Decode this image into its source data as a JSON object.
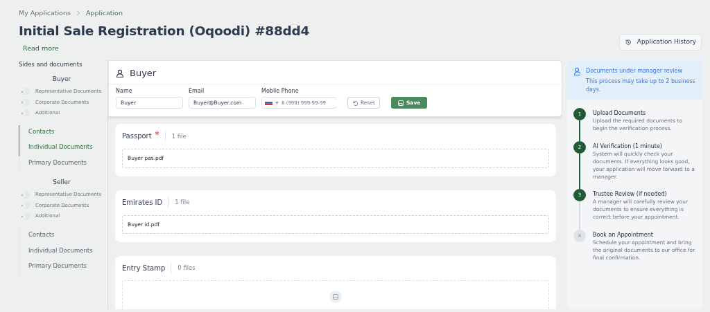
{
  "breadcrumb": [
    {
      "label": "My Applications",
      "selected": false
    },
    {
      "label": "Application",
      "selected": true
    }
  ],
  "title": "Initial Sale Registration (Oqoodi) #88dd4",
  "read_more": "Read more",
  "history_button": "Application History",
  "sidebar": {
    "heading": "Sides and documents",
    "sides": [
      {
        "name": "Buyer",
        "toggles": [
          {
            "label": "Representative Documents",
            "on": false
          },
          {
            "label": "Corporate Documents",
            "on": false
          },
          {
            "label": "Additional",
            "on": false
          }
        ],
        "items": [
          {
            "label": "Contacts",
            "selected": true
          },
          {
            "label": "Individual Documents",
            "selected": true
          },
          {
            "label": "Primary Documents",
            "selected": false
          }
        ]
      },
      {
        "name": "Seller",
        "toggles": [
          {
            "label": "Representative Documents",
            "on": false
          },
          {
            "label": "Corporate Documents",
            "on": false
          },
          {
            "label": "Additional",
            "on": false
          }
        ],
        "items": [
          {
            "label": "Contacts",
            "selected": false
          },
          {
            "label": "Individual Documents",
            "selected": false
          },
          {
            "label": "Primary Documents",
            "selected": false
          }
        ]
      }
    ]
  },
  "contact_card": {
    "title": "Buyer",
    "fields": [
      {
        "kind": "text",
        "label": "Name",
        "value": "Buyer"
      },
      {
        "kind": "text",
        "label": "Email",
        "value": "Buyer@Buyer.com"
      },
      {
        "kind": "phone",
        "label": "Mobile Phone",
        "placeholder": "8 (999) 999-99-99"
      }
    ],
    "reset": "Reset",
    "save": "Save"
  },
  "documents": [
    {
      "title": "Passport",
      "required": true,
      "count": "1 file",
      "files": [
        "Buyer pas.pdf"
      ]
    },
    {
      "title": "Emirates ID",
      "required": false,
      "count": "1 file",
      "files": [
        "Buyer id.pdf"
      ]
    },
    {
      "title": "Entry Stamp",
      "required": false,
      "count": "0 files"
    }
  ],
  "review": {
    "title": "Documents under manager review",
    "text": "This process may take up to 2 business days.",
    "steps": [
      {
        "number": "1",
        "title": "Upload Documents",
        "text": "Upload the required documents to begin the verification process.",
        "done": true
      },
      {
        "number": "2",
        "title": "AI Verification (1 minute)",
        "text": "System will quickly check your documents. If everything looks good, your application will move forward to a manager.",
        "done": true
      },
      {
        "number": "3",
        "title": "Trustee Review (if needed)",
        "text": "A manager will carefully review your documents to ensure everything is correct before your appointment.",
        "done": true
      },
      {
        "number": "4",
        "title": "Book an Appointment",
        "text": "Schedule your appointment and bring the original documents to our office for final confirmation.",
        "done": false
      }
    ]
  }
}
